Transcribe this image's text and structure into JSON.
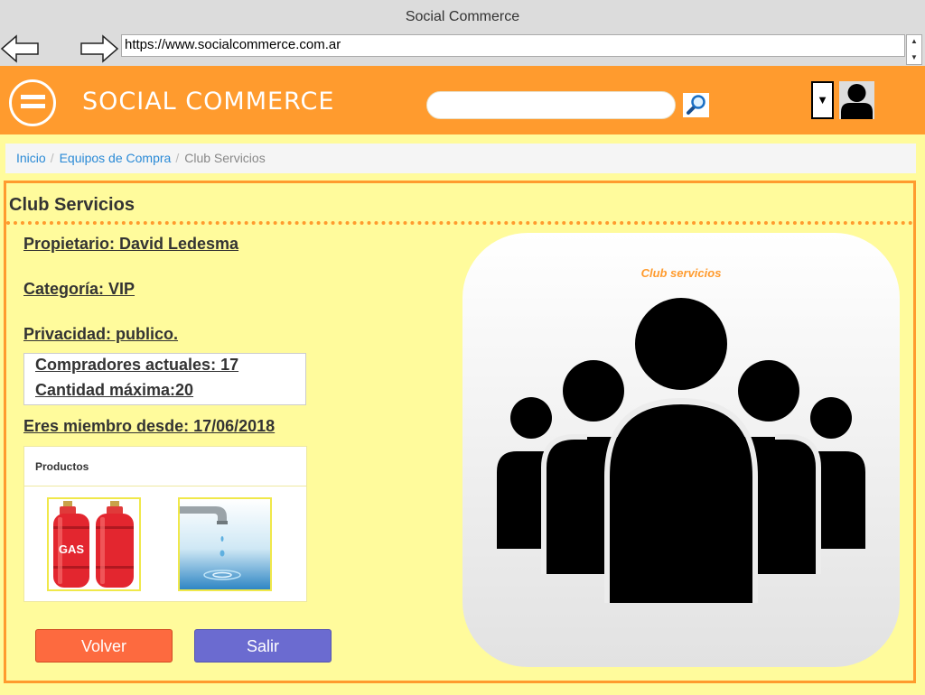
{
  "browser": {
    "window_title": "Social Commerce",
    "url": "https://www.socialcommerce.com.ar",
    "icons": [
      "back-arrow-icon",
      "forward-arrow-icon"
    ]
  },
  "header": {
    "brand": "SOCIAL COMMERCE",
    "search_value": "",
    "user_dropdown_glyph": "▼",
    "colors": {
      "bar": "#ff9b2e",
      "page": "#fffb9c"
    }
  },
  "breadcrumb": {
    "items": [
      "Inicio",
      "Equipos de Compra",
      "Club Servicios"
    ],
    "separator": "/"
  },
  "group": {
    "title": "Club Servicios",
    "owner": "Propietario: David Ledesma",
    "category": "Categoría: VIP",
    "privacy": "Privacidad: publico.",
    "buyers_current": "Compradores actuales: 17",
    "buyers_max": "Cantidad máxima:20",
    "member_since": "Eres miembro desde: 17/06/2018",
    "image_label": "Club servicios"
  },
  "products": {
    "header": "Productos",
    "gas_label": "GAS",
    "items": [
      "gas-cylinders",
      "water-tap"
    ]
  },
  "actions": {
    "back_label": "Volver",
    "exit_label": "Salir",
    "back_color": "#fd6a3f",
    "exit_color": "#6b6bd0"
  }
}
